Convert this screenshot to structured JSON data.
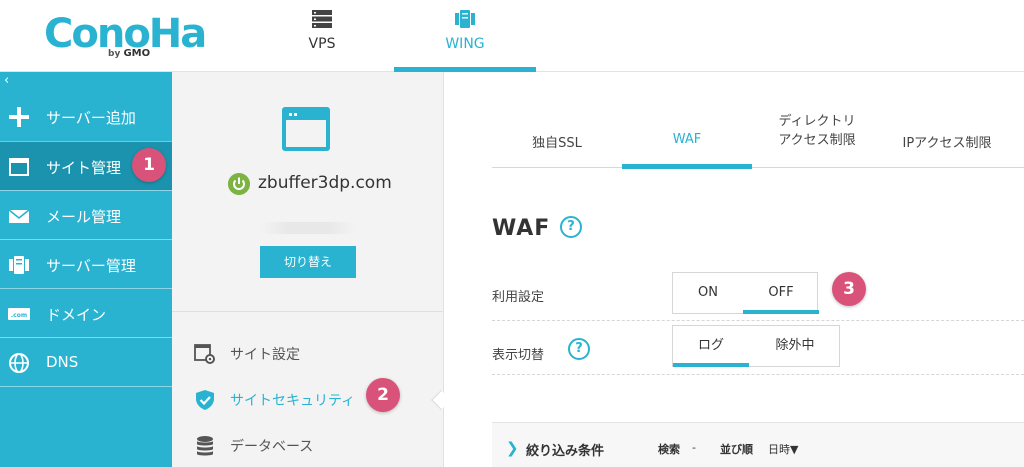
{
  "header": {
    "logo_text": "ConoHa",
    "logo_by": "by",
    "logo_gmo": "GMO",
    "tabs": [
      {
        "label": "VPS",
        "icon": "server-rack-icon"
      },
      {
        "label": "WING",
        "icon": "server-unit-icon",
        "active": true
      }
    ]
  },
  "sidebar": {
    "collapse_glyph": "‹",
    "items": [
      {
        "label": "サーバー追加",
        "icon": "plus-icon"
      },
      {
        "label": "サイト管理",
        "icon": "browser-window-icon",
        "active": true
      },
      {
        "label": "メール管理",
        "icon": "envelope-icon"
      },
      {
        "label": "サーバー管理",
        "icon": "server-icon"
      },
      {
        "label": "ドメイン",
        "icon": "com-domain-icon",
        "icon_text": ".com"
      },
      {
        "label": "DNS",
        "icon": "globe-icon"
      }
    ]
  },
  "site_panel": {
    "domain": "zbuffer3dp.com",
    "switch_label": "切り替え",
    "menu": [
      {
        "label": "サイト設定",
        "icon": "site-settings-icon"
      },
      {
        "label": "サイトセキュリティ",
        "icon": "shield-check-icon",
        "active": true
      },
      {
        "label": "データベース",
        "icon": "database-icon"
      }
    ]
  },
  "main": {
    "tabs": [
      {
        "label": "独自SSL"
      },
      {
        "label": "WAF",
        "active": true
      },
      {
        "label_line1": "ディレクトリ",
        "label_line2": "アクセス制限"
      },
      {
        "label": "IPアクセス制限"
      }
    ],
    "title": "WAF",
    "help_glyph": "?",
    "use_setting": {
      "label": "利用設定",
      "options": [
        "ON",
        "OFF"
      ],
      "selected": "OFF"
    },
    "display_switch": {
      "label": "表示切替",
      "options": [
        "ログ",
        "除外中"
      ],
      "selected": "ログ"
    },
    "filter": {
      "chevron": "❯",
      "label": "絞り込み条件",
      "search_label": "検索",
      "search_value": "-",
      "sort_label": "並び順",
      "sort_value": "日時▼"
    }
  },
  "badges": [
    "1",
    "2",
    "3"
  ],
  "colors": {
    "accent": "#2ab3d1",
    "sidebar_active": "#1b93ae",
    "badge": "#d9527a",
    "power_green": "#7cb342"
  }
}
